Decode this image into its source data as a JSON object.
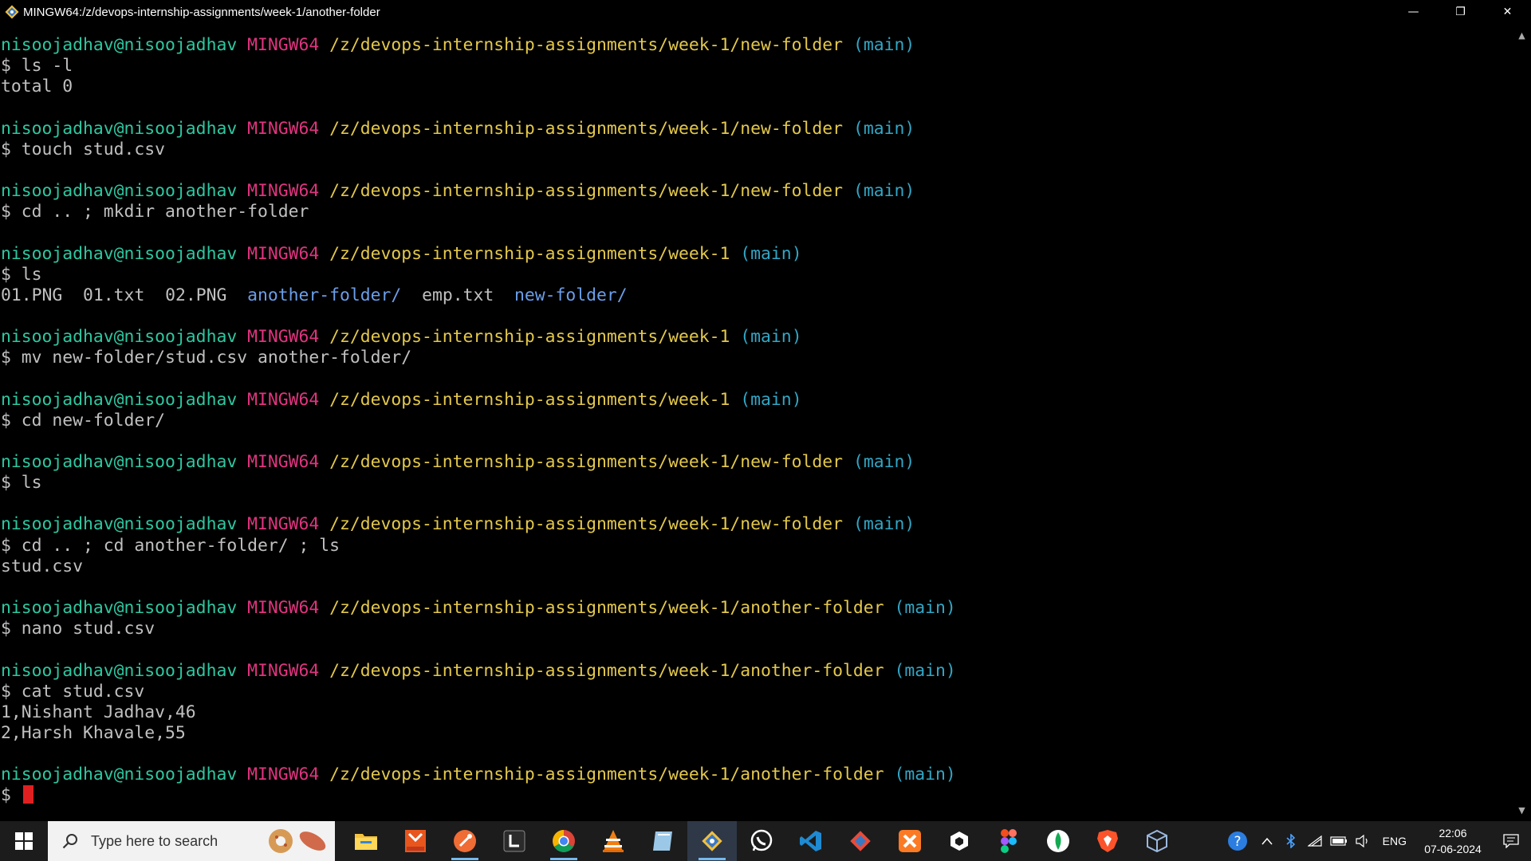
{
  "window": {
    "title": "MINGW64:/z/devops-internship-assignments/week-1/another-folder",
    "minimize_glyph": "—",
    "maximize_glyph": "❐",
    "close_glyph": "✕"
  },
  "terminal": {
    "lines": [
      {
        "kind": "prompt",
        "user": "nisoojadhav@nisoojadhav",
        "host": "MINGW64",
        "path": "/z/devops-internship-assignments/week-1/new-folder",
        "branch": "(main)"
      },
      {
        "kind": "cmd",
        "text": "$ ls -l"
      },
      {
        "kind": "out",
        "text": "total 0"
      },
      {
        "kind": "blank"
      },
      {
        "kind": "prompt",
        "user": "nisoojadhav@nisoojadhav",
        "host": "MINGW64",
        "path": "/z/devops-internship-assignments/week-1/new-folder",
        "branch": "(main)"
      },
      {
        "kind": "cmd",
        "text": "$ touch stud.csv"
      },
      {
        "kind": "blank"
      },
      {
        "kind": "prompt",
        "user": "nisoojadhav@nisoojadhav",
        "host": "MINGW64",
        "path": "/z/devops-internship-assignments/week-1/new-folder",
        "branch": "(main)"
      },
      {
        "kind": "cmd",
        "text": "$ cd .. ; mkdir another-folder"
      },
      {
        "kind": "blank"
      },
      {
        "kind": "prompt",
        "user": "nisoojadhav@nisoojadhav",
        "host": "MINGW64",
        "path": "/z/devops-internship-assignments/week-1",
        "branch": "(main)"
      },
      {
        "kind": "cmd",
        "text": "$ ls"
      },
      {
        "kind": "ls",
        "items": [
          {
            "name": "01.PNG",
            "dir": false
          },
          {
            "name": "01.txt",
            "dir": false
          },
          {
            "name": "02.PNG",
            "dir": false
          },
          {
            "name": "another-folder/",
            "dir": true
          },
          {
            "name": "emp.txt",
            "dir": false
          },
          {
            "name": "new-folder/",
            "dir": true
          }
        ]
      },
      {
        "kind": "blank"
      },
      {
        "kind": "prompt",
        "user": "nisoojadhav@nisoojadhav",
        "host": "MINGW64",
        "path": "/z/devops-internship-assignments/week-1",
        "branch": "(main)"
      },
      {
        "kind": "cmd",
        "text": "$ mv new-folder/stud.csv another-folder/"
      },
      {
        "kind": "blank"
      },
      {
        "kind": "prompt",
        "user": "nisoojadhav@nisoojadhav",
        "host": "MINGW64",
        "path": "/z/devops-internship-assignments/week-1",
        "branch": "(main)"
      },
      {
        "kind": "cmd",
        "text": "$ cd new-folder/"
      },
      {
        "kind": "blank"
      },
      {
        "kind": "prompt",
        "user": "nisoojadhav@nisoojadhav",
        "host": "MINGW64",
        "path": "/z/devops-internship-assignments/week-1/new-folder",
        "branch": "(main)"
      },
      {
        "kind": "cmd",
        "text": "$ ls"
      },
      {
        "kind": "blank"
      },
      {
        "kind": "prompt",
        "user": "nisoojadhav@nisoojadhav",
        "host": "MINGW64",
        "path": "/z/devops-internship-assignments/week-1/new-folder",
        "branch": "(main)"
      },
      {
        "kind": "cmd",
        "text": "$ cd .. ; cd another-folder/ ; ls"
      },
      {
        "kind": "out",
        "text": "stud.csv"
      },
      {
        "kind": "blank"
      },
      {
        "kind": "prompt",
        "user": "nisoojadhav@nisoojadhav",
        "host": "MINGW64",
        "path": "/z/devops-internship-assignments/week-1/another-folder",
        "branch": "(main)"
      },
      {
        "kind": "cmd",
        "text": "$ nano stud.csv"
      },
      {
        "kind": "blank"
      },
      {
        "kind": "prompt",
        "user": "nisoojadhav@nisoojadhav",
        "host": "MINGW64",
        "path": "/z/devops-internship-assignments/week-1/another-folder",
        "branch": "(main)"
      },
      {
        "kind": "cmd",
        "text": "$ cat stud.csv"
      },
      {
        "kind": "out",
        "text": "1,Nishant Jadhav,46"
      },
      {
        "kind": "out",
        "text": "2,Harsh Khavale,55"
      },
      {
        "kind": "blank"
      },
      {
        "kind": "prompt",
        "user": "nisoojadhav@nisoojadhav",
        "host": "MINGW64",
        "path": "/z/devops-internship-assignments/week-1/another-folder",
        "branch": "(main)"
      },
      {
        "kind": "current",
        "text": "$ "
      }
    ]
  },
  "taskbar": {
    "search_placeholder": "Type here to search",
    "apps": [
      {
        "name": "file-explorer-icon",
        "running": false,
        "active": false
      },
      {
        "name": "pdf-reader-icon",
        "running": false,
        "active": false
      },
      {
        "name": "postman-icon",
        "running": true,
        "active": false
      },
      {
        "name": "lightshot-icon",
        "running": false,
        "active": false
      },
      {
        "name": "chrome-icon",
        "running": true,
        "active": false
      },
      {
        "name": "vlc-icon",
        "running": false,
        "active": false
      },
      {
        "name": "notes-icon",
        "running": false,
        "active": false
      },
      {
        "name": "git-bash-icon",
        "running": true,
        "active": true
      },
      {
        "name": "whatsapp-icon",
        "running": false,
        "active": false
      },
      {
        "name": "vscode-icon",
        "running": false,
        "active": false
      },
      {
        "name": "git-gui-icon",
        "running": false,
        "active": false
      },
      {
        "name": "xampp-icon",
        "running": false,
        "active": false
      },
      {
        "name": "unity-icon",
        "running": false,
        "active": false
      },
      {
        "name": "figma-icon",
        "running": false,
        "active": false
      },
      {
        "name": "mongodb-compass-icon",
        "running": false,
        "active": false
      },
      {
        "name": "brave-icon",
        "running": false,
        "active": false
      },
      {
        "name": "virtualbox-icon",
        "running": false,
        "active": false
      }
    ],
    "language": "ENG",
    "time": "22:06",
    "date": "07-06-2024"
  },
  "colors": {
    "user": "#2ec7a0",
    "host": "#e0347f",
    "path": "#e3c84b",
    "branch": "#32a6c5",
    "text": "#c0c0c0",
    "dir": "#6b9ee8",
    "cursor": "#e02020"
  }
}
